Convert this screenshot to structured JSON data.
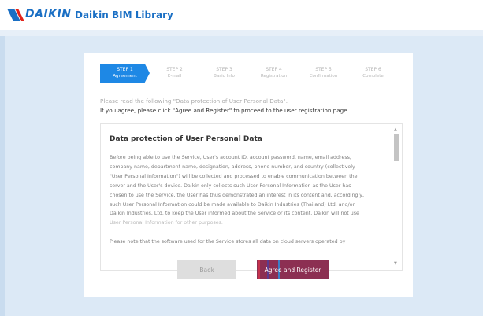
{
  "header": {
    "brand": "DAIKIN",
    "title": "Daikin BIM Library"
  },
  "steps": [
    {
      "num": "STEP 1",
      "label": "Agreement",
      "active": true
    },
    {
      "num": "STEP 2",
      "label": "E-mail",
      "active": false
    },
    {
      "num": "STEP 3",
      "label": "Basic Info",
      "active": false
    },
    {
      "num": "STEP 4",
      "label": "Registration",
      "active": false
    },
    {
      "num": "STEP 5",
      "label": "Confirmation",
      "active": false
    },
    {
      "num": "STEP 6",
      "label": "Complete",
      "active": false
    }
  ],
  "instructions": {
    "line1": "Please read the following \"Data protection of User Personal Data\".",
    "line2": "If you agree, please click \"Agree and Register\" to proceed to the user registration page."
  },
  "terms": {
    "title": "Data protection of User Personal Data",
    "paragraph1": [
      "Before being able to use the Service, User's account ID, account password, name, email address,",
      "company name, department name, designation, address, phone number, and country (collectively",
      "\"User Personal Information\") will be collected and processed to enable communication between the",
      "server and the User's device. Daikin only collects such User Personal Information as the User has",
      "chosen to use the Service, the User has thus demonstrated an interest in its content and, accordingly,",
      "such User Personal Information could be made available to Daikin Industries (Thailand) Ltd. and/or",
      "Daikin Industries, Ltd. to keep the User informed about the Service or its content. Daikin will not use",
      "User Personal Information for other purposes."
    ],
    "paragraph2": "Please note that the software used for the Service stores all data on cloud servers operated by"
  },
  "buttons": {
    "back": "Back",
    "agree": "Agree and Register"
  },
  "colors": {
    "brand_blue": "#1a6fc4",
    "active_step": "#1e88e5",
    "agree_button": "#8c2f52",
    "background": "#dce9f6"
  }
}
